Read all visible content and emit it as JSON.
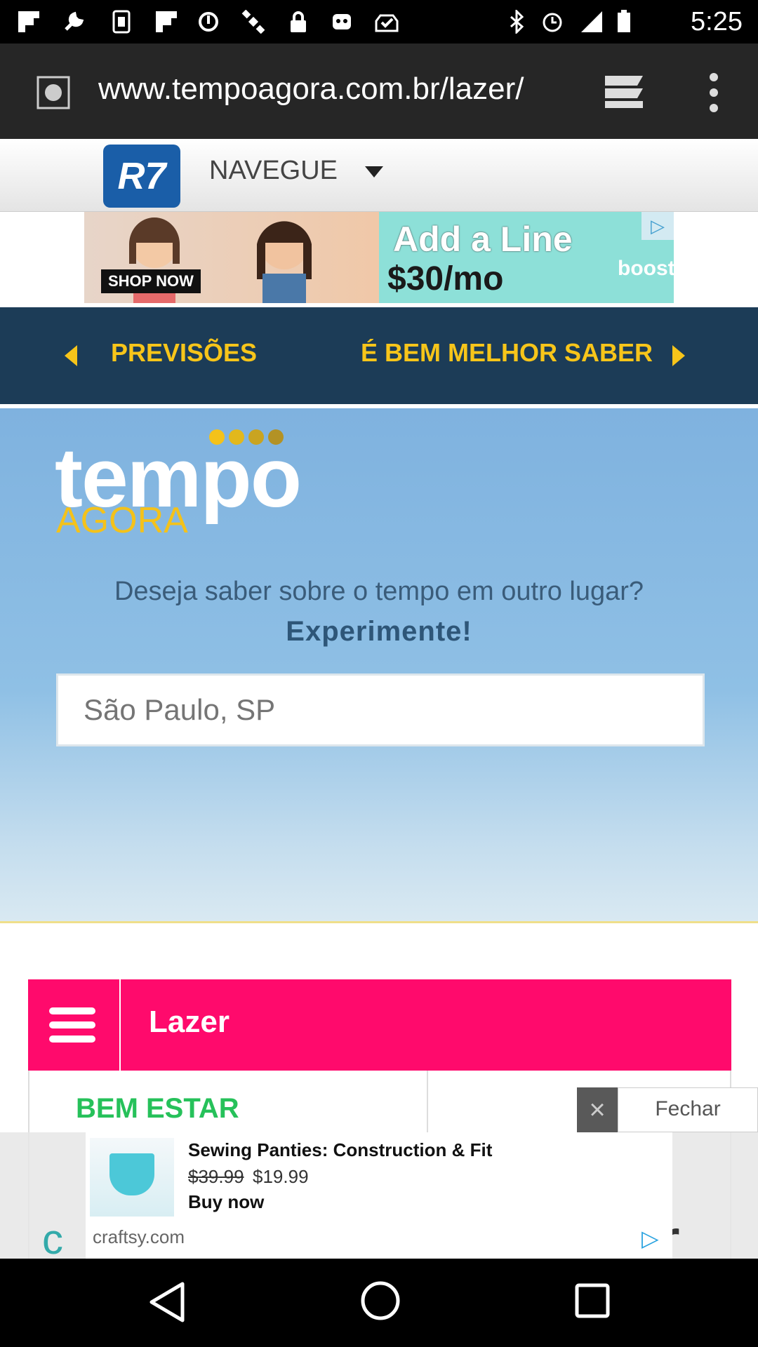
{
  "status_bar": {
    "time": "5:25",
    "left_icons": [
      "flipboard-icon",
      "wrench-icon",
      "sim-icon",
      "flipboard-icon",
      "sync-icon",
      "satellite-icon",
      "lock-icon",
      "robot-icon",
      "inbox-check-icon"
    ],
    "right_icons": [
      "bluetooth-icon",
      "alarm-icon",
      "signal-icon",
      "battery-icon"
    ]
  },
  "browser": {
    "url": "www.tempoagora.com.br/lazer/",
    "progress": 0.98
  },
  "r7_header": {
    "logo": "R7",
    "nav_label": "NAVEGUE"
  },
  "top_ad": {
    "title": "Add a Line",
    "price": "$30/mo",
    "cta": "SHOP NOW",
    "brand": "boost"
  },
  "nav_strip": {
    "prev_label": "PREVISÕES",
    "next_label": "É BEM MELHOR SABER"
  },
  "hero": {
    "logo_top": "tempo",
    "logo_bottom": "AGORA",
    "prompt": "Deseja saber sobre o tempo em outro lugar?",
    "cta": "Experimente!",
    "search_placeholder": "São Paulo, SP"
  },
  "section": {
    "title": "Lazer",
    "category": "BEM ESTAR"
  },
  "overlay_ad": {
    "close_label": "Fechar",
    "title": "Sewing Panties: Construction & Fit",
    "old_price": "$39.99",
    "new_price": "$19.99",
    "cta": "Buy now",
    "domain": "craftsy.com"
  },
  "colors": {
    "accent_pink": "#ff0a6c",
    "nav_dark": "#1c3c57",
    "yellow": "#f7c51a",
    "green": "#26c15a"
  }
}
